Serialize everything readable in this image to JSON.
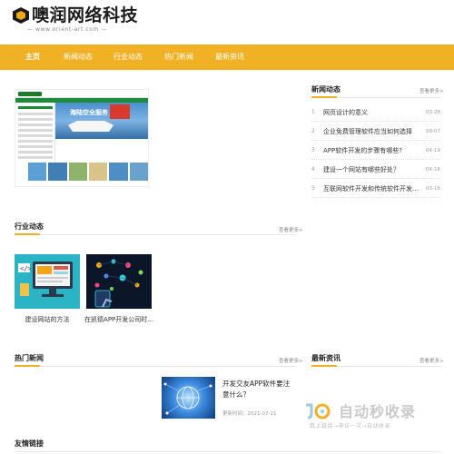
{
  "header": {
    "logo_text": "噢润网络科技",
    "logo_sub": "www.orient-art.com"
  },
  "nav": {
    "items": [
      {
        "label": "主页",
        "active": true
      },
      {
        "label": "新闻动态"
      },
      {
        "label": "行业动态"
      },
      {
        "label": "热门新闻"
      },
      {
        "label": "最新资讯"
      }
    ]
  },
  "banner": {
    "caption": "海陆空全服务"
  },
  "news_section": {
    "title": "新闻动态",
    "more": "查看更多>",
    "items": [
      {
        "num": "1",
        "title": "网页设计的意义",
        "date": "03-28"
      },
      {
        "num": "2",
        "title": "企业免费管理软件应当如何选择",
        "date": "09-07"
      },
      {
        "num": "3",
        "title": "APP软件开发的步骤有哪些?",
        "date": "04-19"
      },
      {
        "num": "4",
        "title": "建设一个网站有哪些好处？",
        "date": "04-16"
      },
      {
        "num": "5",
        "title": "互联网软件开发和传统软件开发有什么...",
        "date": "03-16"
      }
    ]
  },
  "industry_section": {
    "title": "行业动态",
    "more": "查看更多>",
    "cards": [
      {
        "caption": "建设网站的方法"
      },
      {
        "caption": "在凯德APP开发公司时..."
      }
    ]
  },
  "hot_section": {
    "title": "热门新闻",
    "more": "查看更多>",
    "item": {
      "title": "开发交友APP软件要注意什么？",
      "time": "更新时间：2021-07-21"
    }
  },
  "latest_section": {
    "title": "最新资讯",
    "more": "查看更多>"
  },
  "links_section": {
    "title": "友情链接"
  },
  "watermark": {
    "text": "自动秒收录",
    "sub": "数上链接→来访一次→自动收录"
  },
  "colors": {
    "accent": "#f0b125",
    "nav_text": "#ffffff"
  }
}
